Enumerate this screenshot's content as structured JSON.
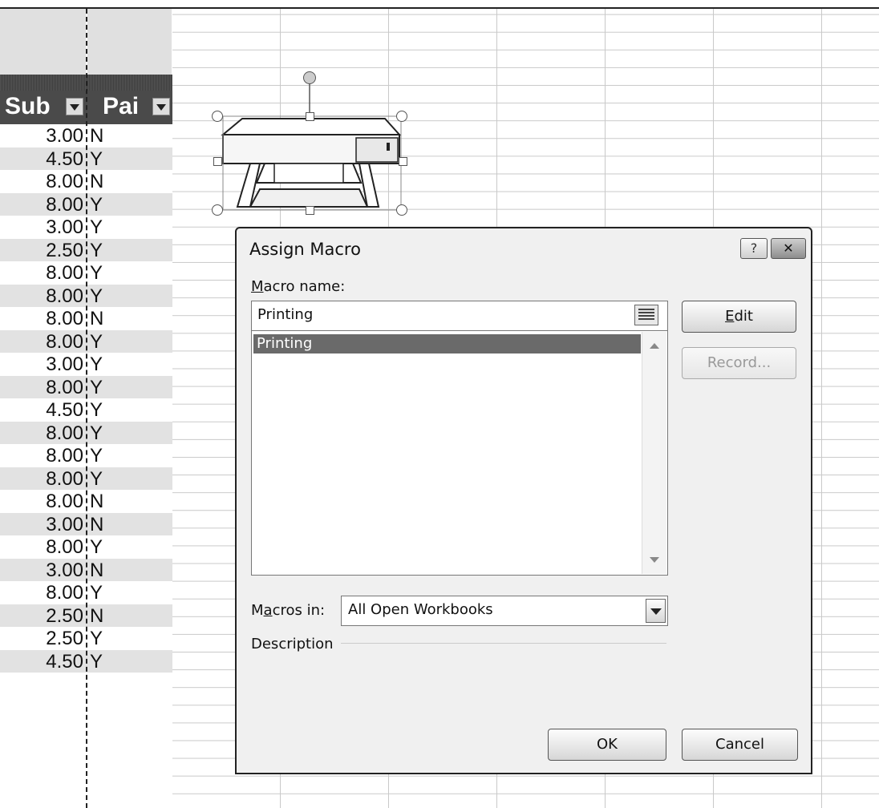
{
  "sheet": {
    "headers": {
      "col_a": "Sub",
      "col_b": "Pai"
    },
    "rows": [
      {
        "sub": "3.00",
        "paid": "N"
      },
      {
        "sub": "4.50",
        "paid": "Y"
      },
      {
        "sub": "8.00",
        "paid": "N"
      },
      {
        "sub": "8.00",
        "paid": "Y"
      },
      {
        "sub": "3.00",
        "paid": "Y"
      },
      {
        "sub": "2.50",
        "paid": "Y"
      },
      {
        "sub": "8.00",
        "paid": "Y"
      },
      {
        "sub": "8.00",
        "paid": "Y"
      },
      {
        "sub": "8.00",
        "paid": "N"
      },
      {
        "sub": "8.00",
        "paid": "Y"
      },
      {
        "sub": "3.00",
        "paid": "Y"
      },
      {
        "sub": "8.00",
        "paid": "Y"
      },
      {
        "sub": "4.50",
        "paid": "Y"
      },
      {
        "sub": "8.00",
        "paid": "Y"
      },
      {
        "sub": "8.00",
        "paid": "Y"
      },
      {
        "sub": "8.00",
        "paid": "Y"
      },
      {
        "sub": "8.00",
        "paid": "N"
      },
      {
        "sub": "3.00",
        "paid": "N"
      },
      {
        "sub": "8.00",
        "paid": "Y"
      },
      {
        "sub": "3.00",
        "paid": "N"
      },
      {
        "sub": "8.00",
        "paid": "Y"
      },
      {
        "sub": "2.50",
        "paid": "N"
      },
      {
        "sub": "2.50",
        "paid": "Y"
      },
      {
        "sub": "4.50",
        "paid": "Y"
      }
    ]
  },
  "dialog": {
    "title": "Assign Macro",
    "help_label": "?",
    "close_label": "✕",
    "macro_name_label": {
      "accel": "M",
      "rest": "acro name:"
    },
    "macro_name_value": "Printing",
    "macros": [
      "Printing"
    ],
    "edit_label": {
      "accel": "E",
      "rest": "dit"
    },
    "record_label": "Record...",
    "macros_in_label": {
      "pre": "M",
      "accel": "a",
      "rest": "cros in:"
    },
    "macros_in_value": "All Open Workbooks",
    "description_label": "Description",
    "ok_label": "OK",
    "cancel_label": "Cancel"
  }
}
